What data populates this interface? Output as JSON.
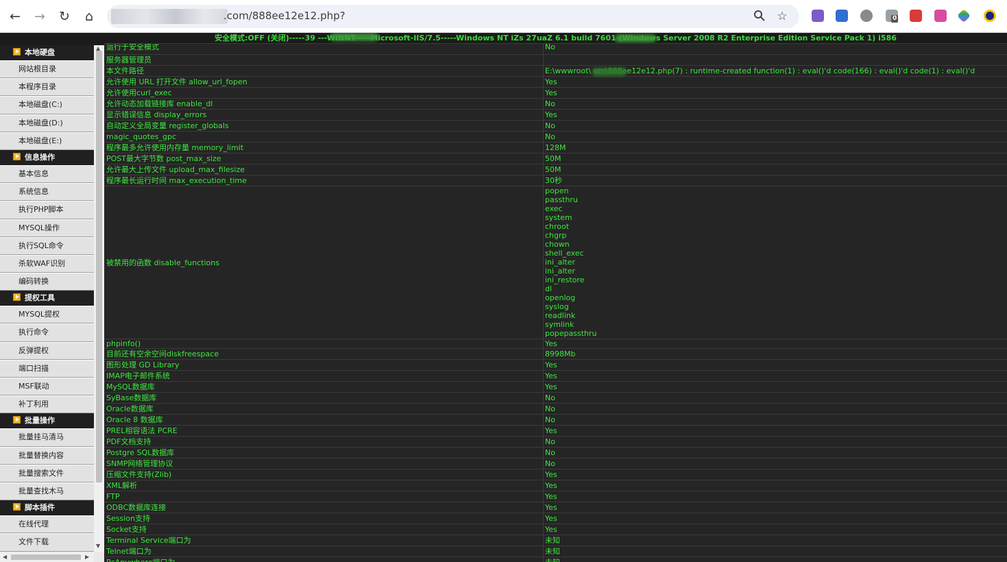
{
  "browser": {
    "url_suffix": ".com/888ee12e12.php?",
    "back": "←",
    "forward": "→",
    "reload": "↻",
    "home": "⌂",
    "zoom_icon": "search-icon",
    "star_icon": "star-icon",
    "extension_badge": "0"
  },
  "status_line": "安全模式:OFF (关闭)-----39                    ---WINNT-----Microsoft-IIS/7.5-----Windows NT iZs           27uaZ 6.1 build 7601 (Windows Server 2008 R2 Enterprise Edition Service Pack 1) i586",
  "sidebar": {
    "sections": [
      {
        "title": "本地硬盘",
        "items": [
          "网站根目录",
          "本程序目录",
          "本地磁盘(C:)",
          "本地磁盘(D:)",
          "本地磁盘(E:)"
        ]
      },
      {
        "title": "信息操作",
        "items": [
          "基本信息",
          "系统信息",
          "执行PHP脚本",
          "MYSQL操作",
          "执行SQL命令",
          "杀软WAF识别",
          "编码转换"
        ]
      },
      {
        "title": "提权工具",
        "items": [
          "MYSQL提权",
          "执行命令",
          "反弹提权",
          "端口扫描",
          "MSF联动",
          "补丁利用"
        ]
      },
      {
        "title": "批量操作",
        "items": [
          "批量挂马清马",
          "批量替换内容",
          "批量搜索文件",
          "批量查找木马"
        ]
      },
      {
        "title": "脚本插件",
        "items": [
          "在线代理",
          "文件下载"
        ]
      }
    ]
  },
  "info_rows": [
    {
      "key": "运行于安全模式",
      "value": "No"
    },
    {
      "key": "服务器管理员",
      "value": ""
    },
    {
      "key": "本文件路径",
      "value": "E:\\wwwroot\\          om\\888ee12e12.php(7) : runtime-created function(1) : eval()'d code(166) : eval()'d code(1) : eval()'d"
    },
    {
      "key": "允许使用 URL 打开文件 allow_url_fopen",
      "value": "Yes"
    },
    {
      "key": "允许使用curl_exec",
      "value": "Yes"
    },
    {
      "key": "允许动态加载链接库 enable_dl",
      "value": "No"
    },
    {
      "key": "显示错误信息 display_errors",
      "value": "Yes"
    },
    {
      "key": "自动定义全局变量 register_globals",
      "value": "No"
    },
    {
      "key": "magic_quotes_gpc",
      "value": "No"
    },
    {
      "key": "程序最多允许使用内存量 memory_limit",
      "value": "128M"
    },
    {
      "key": "POST最大字节数 post_max_size",
      "value": "50M"
    },
    {
      "key": "允许最大上传文件 upload_max_filesize",
      "value": "50M"
    },
    {
      "key": "程序最长运行时间 max_execution_time",
      "value": "30秒"
    }
  ],
  "disabled": {
    "key": "被禁用的函数 disable_functions",
    "functions": [
      "popen",
      "passthru",
      "exec",
      "system",
      "chroot",
      "chgrp",
      "chown",
      "shell_exec",
      "ini_alter",
      "ini_alter",
      "ini_restore",
      "dl",
      "openlog",
      "syslog",
      "readlink",
      "symlink",
      "popepassthru"
    ]
  },
  "info_rows2": [
    {
      "key": "phpinfo()",
      "value": "Yes"
    },
    {
      "key": "目前还有空余空间diskfreespace",
      "value": "8998Mb"
    },
    {
      "key": "图形处理 GD Library",
      "value": "Yes"
    },
    {
      "key": "IMAP电子邮件系统",
      "value": "Yes"
    },
    {
      "key": "MySQL数据库",
      "value": "Yes"
    },
    {
      "key": "SyBase数据库",
      "value": "No"
    },
    {
      "key": "Oracle数据库",
      "value": "No"
    },
    {
      "key": "Oracle 8 数据库",
      "value": "No"
    },
    {
      "key": "PREL相容语法 PCRE",
      "value": "Yes"
    },
    {
      "key": "PDF文档支持",
      "value": "No"
    },
    {
      "key": "Postgre SQL数据库",
      "value": "No"
    },
    {
      "key": "SNMP网络管理协议",
      "value": "No"
    },
    {
      "key": "压缩文件支持(Zlib)",
      "value": "Yes"
    },
    {
      "key": "XML解析",
      "value": "Yes"
    },
    {
      "key": "FTP",
      "value": "Yes"
    },
    {
      "key": "ODBC数据库连接",
      "value": "Yes"
    },
    {
      "key": "Session支持",
      "value": "Yes"
    },
    {
      "key": "Socket支持",
      "value": "Yes"
    },
    {
      "key": "Terminal Service端口为",
      "value": "未知"
    },
    {
      "key": "Telnet端口为",
      "value": "未知"
    },
    {
      "key": "PcAnywhere端口为",
      "value": "未知"
    }
  ],
  "colors": {
    "accent_green": "#3ee63e",
    "background": "#252525",
    "sidebar_header": "#202020"
  }
}
